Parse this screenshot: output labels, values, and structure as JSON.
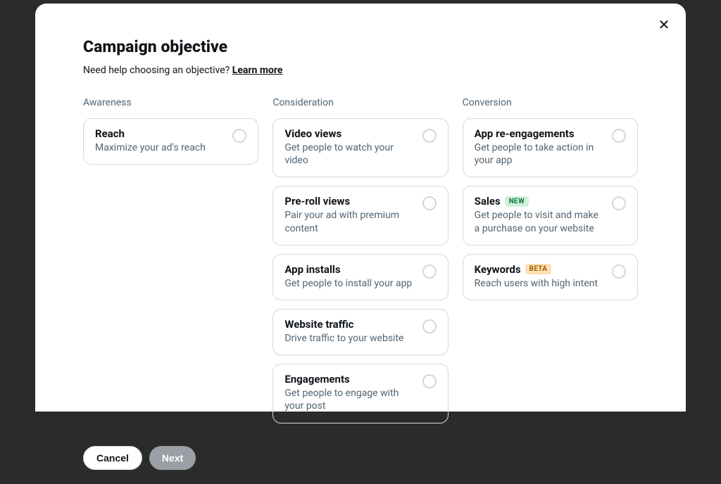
{
  "title": "Campaign objective",
  "help": {
    "text": "Need help choosing an objective? ",
    "link": "Learn more"
  },
  "columns": {
    "awareness": {
      "header": "Awareness",
      "options": [
        {
          "title": "Reach",
          "desc": "Maximize your ad's reach"
        }
      ]
    },
    "consideration": {
      "header": "Consideration",
      "options": [
        {
          "title": "Video views",
          "desc": "Get people to watch your video"
        },
        {
          "title": "Pre-roll views",
          "desc": "Pair your ad with premium content"
        },
        {
          "title": "App installs",
          "desc": "Get people to install your app"
        },
        {
          "title": "Website traffic",
          "desc": "Drive traffic to your website"
        },
        {
          "title": "Engagements",
          "desc": "Get people to engage with your post"
        }
      ]
    },
    "conversion": {
      "header": "Conversion",
      "options": [
        {
          "title": "App re-engagements",
          "desc": "Get people to take action in your app"
        },
        {
          "title": "Sales",
          "badge": "NEW",
          "desc": "Get people to visit and make a purchase on your website"
        },
        {
          "title": "Keywords",
          "badge": "BETA",
          "desc": "Reach users with high intent"
        }
      ]
    }
  },
  "footer": {
    "cancel": "Cancel",
    "next": "Next"
  }
}
